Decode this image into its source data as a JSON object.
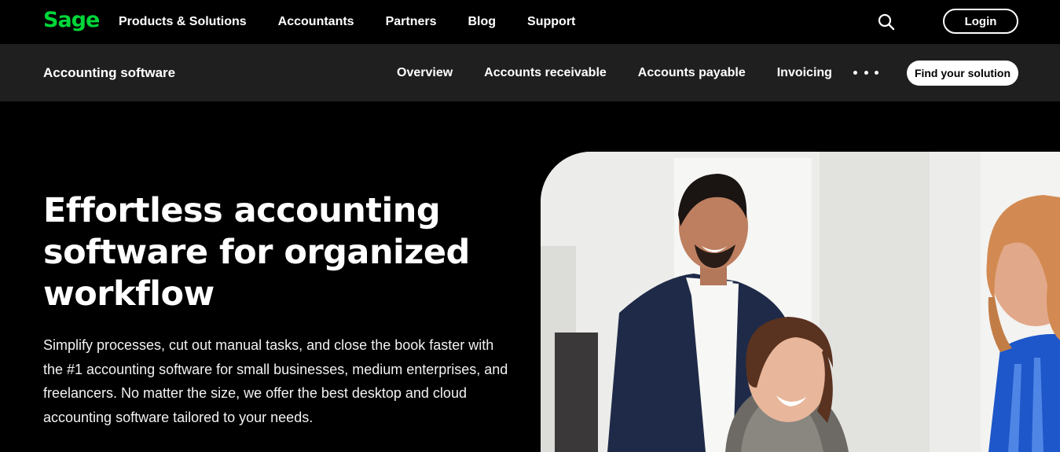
{
  "brand": {
    "logo_text": "Sage",
    "accent_color": "#00d639"
  },
  "topnav": {
    "items": [
      {
        "label": "Products & Solutions"
      },
      {
        "label": "Accountants"
      },
      {
        "label": "Partners"
      },
      {
        "label": "Blog"
      },
      {
        "label": "Support"
      }
    ],
    "search_icon": "search-icon",
    "login_label": "Login"
  },
  "subnav": {
    "title": "Accounting software",
    "items": [
      {
        "label": "Overview"
      },
      {
        "label": "Accounts receivable"
      },
      {
        "label": "Accounts payable"
      },
      {
        "label": "Invoicing"
      }
    ],
    "more_icon": "more-icon",
    "cta_label": "Find your solution"
  },
  "hero": {
    "title": "Effortless accounting software for organized workflow",
    "body": "Simplify processes, cut out manual tasks, and close the book faster with the #1 accounting software for small businesses, medium enterprises, and freelancers. No matter the size, we offer the best desktop and cloud accounting software tailored to your needs."
  },
  "colors": {
    "page_background": "#000000",
    "subnav_background": "#1f1f1f",
    "text": "#ffffff"
  }
}
